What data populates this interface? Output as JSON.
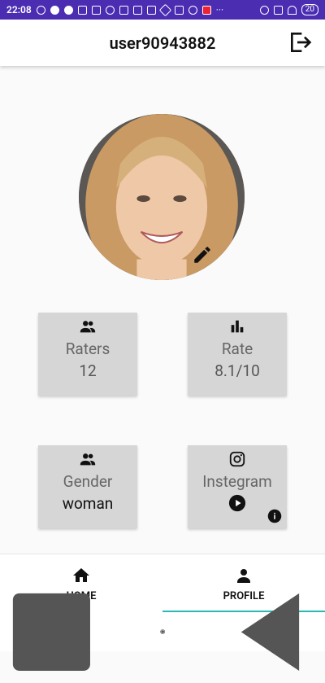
{
  "statusbar": {
    "time": "22:08",
    "battery": "20"
  },
  "appbar": {
    "username": "user90943882"
  },
  "stats": {
    "raters_label": "Raters",
    "raters_value": "12",
    "rate_label": "Rate",
    "rate_value": "8.1/10",
    "gender_label": "Gender",
    "gender_value": "woman",
    "instagram_label": "Instegram"
  },
  "bottomnav": {
    "items": [
      {
        "label": "HOME",
        "icon": "home-icon"
      },
      {
        "label": "PROFILE",
        "icon": "person-icon",
        "active": true
      }
    ]
  },
  "colors": {
    "statusbar": "#4b2db2",
    "accent": "#2bb7b7",
    "card": "#d6d6d6"
  }
}
